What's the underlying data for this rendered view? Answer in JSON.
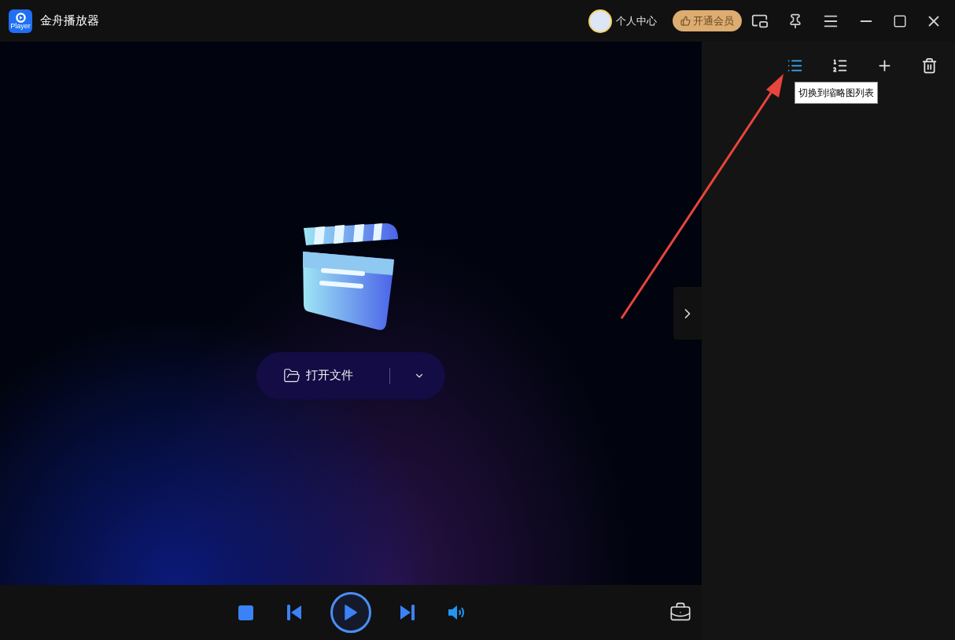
{
  "app": {
    "title": "金舟播放器",
    "logo_text": "Player"
  },
  "header": {
    "user_center": "个人中心",
    "vip_button": "开通会员"
  },
  "playlist_toolbar": [
    {
      "kind": "list",
      "selected": true
    },
    {
      "kind": "numbered",
      "selected": false
    },
    {
      "kind": "add",
      "selected": false
    },
    {
      "kind": "delete",
      "selected": false
    }
  ],
  "tooltip": "切换到缩略图列表",
  "open_file": {
    "label": "打开文件"
  },
  "controls": [
    {
      "kind": "stop"
    },
    {
      "kind": "prev"
    },
    {
      "kind": "play"
    },
    {
      "kind": "next"
    },
    {
      "kind": "volume"
    }
  ]
}
